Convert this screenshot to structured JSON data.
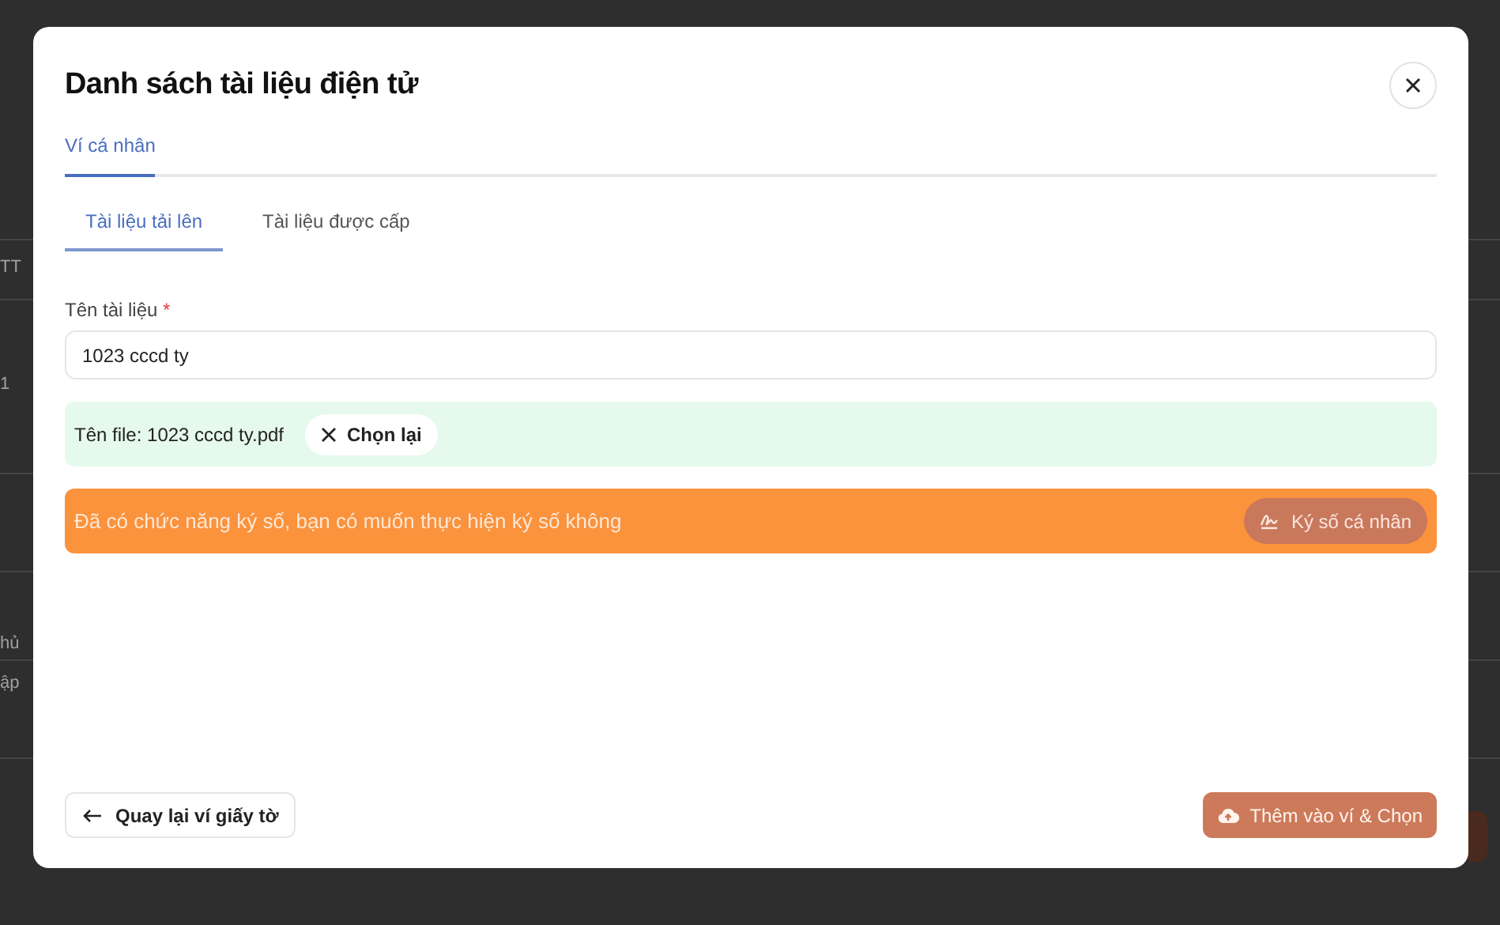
{
  "background": {
    "fragments": [
      "TT",
      "1",
      "hủ",
      "ập"
    ]
  },
  "dialog": {
    "title": "Danh sách tài liệu điện tử",
    "tabs": [
      {
        "label": "Ví cá nhân",
        "selected": true
      }
    ],
    "subtabs": [
      {
        "label": "Tài liệu tải lên",
        "selected": true
      },
      {
        "label": "Tài liệu được cấp",
        "selected": false
      }
    ],
    "field": {
      "label": "Tên tài liệu",
      "required_mark": "*",
      "value": "1023 cccd ty"
    },
    "file": {
      "text": "Tên file: 1023 cccd ty.pdf",
      "button": "Chọn lại"
    },
    "sign_banner": {
      "message": "Đã có chức năng ký số, bạn có muốn thực hiện ký số không",
      "button": "Ký số cá nhân"
    },
    "footer": {
      "back_button": "Quay lại ví giấy tờ",
      "submit_button": "Thêm vào ví & Chọn"
    }
  }
}
